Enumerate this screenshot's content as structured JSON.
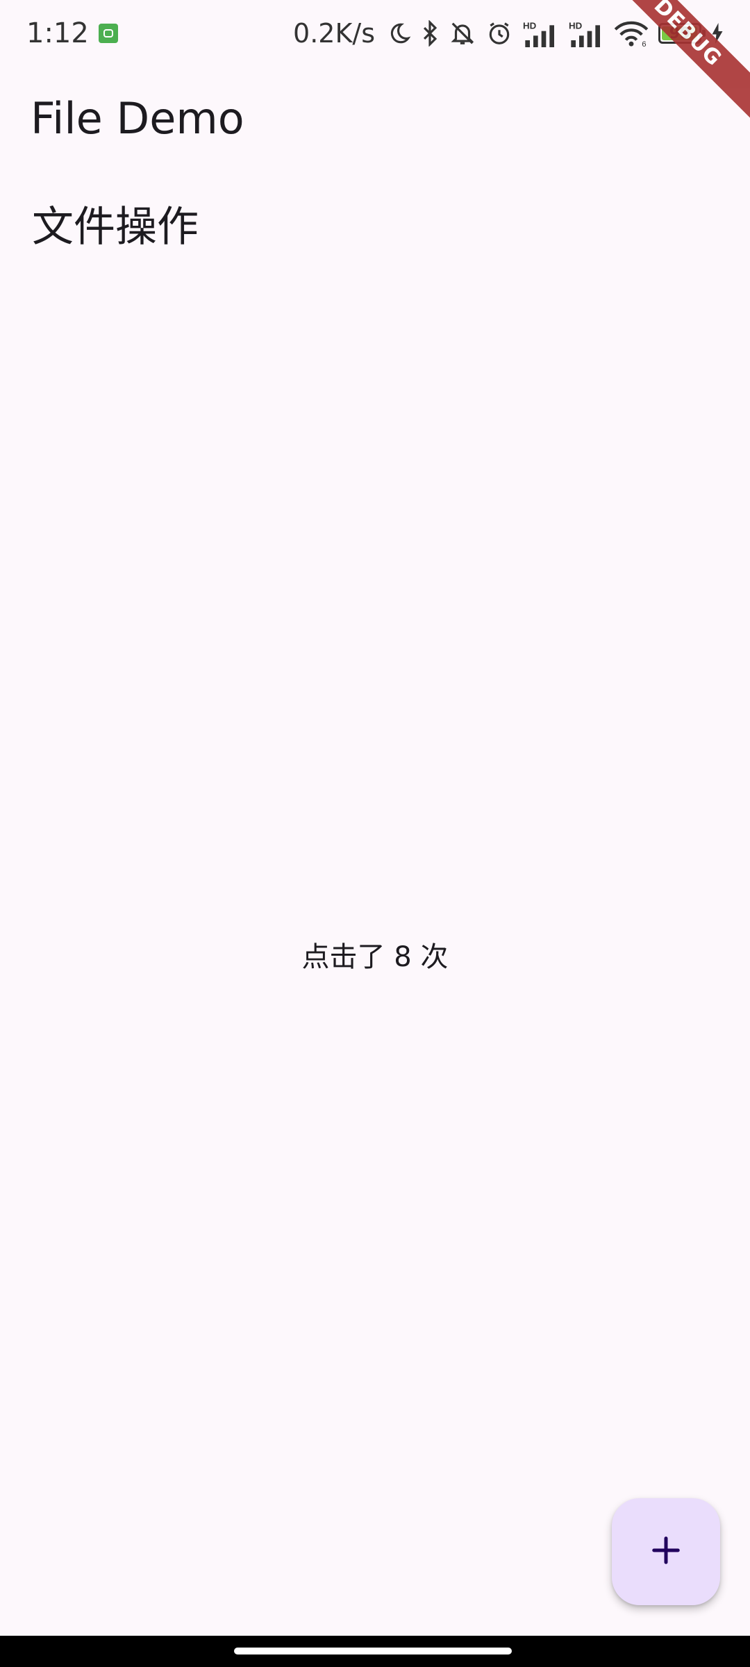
{
  "status_bar": {
    "time": "1:12",
    "net_speed": "0.2K/s",
    "battery_level": "99",
    "battery_percent": 99,
    "icons": [
      "app-notification-icon",
      "moon-icon",
      "bluetooth-icon",
      "bell-off-icon",
      "alarm-icon",
      "signal-hd-icon",
      "signal-hd-icon",
      "wifi-icon",
      "battery-icon",
      "charging-bolt-icon"
    ],
    "signal_labels": [
      "HD",
      "HD"
    ],
    "wifi_label": "6"
  },
  "debug_banner": "DEBUG",
  "app_bar": {
    "title": "File Demo"
  },
  "main": {
    "section_heading": "文件操作",
    "counter_text": "点击了 8 次"
  },
  "fab": {
    "icon": "plus-icon",
    "color": "#eaddfc"
  },
  "colors": {
    "background": "#fdf8fc",
    "debug_ribbon": "#a83232",
    "fab_icon": "#21005d"
  }
}
